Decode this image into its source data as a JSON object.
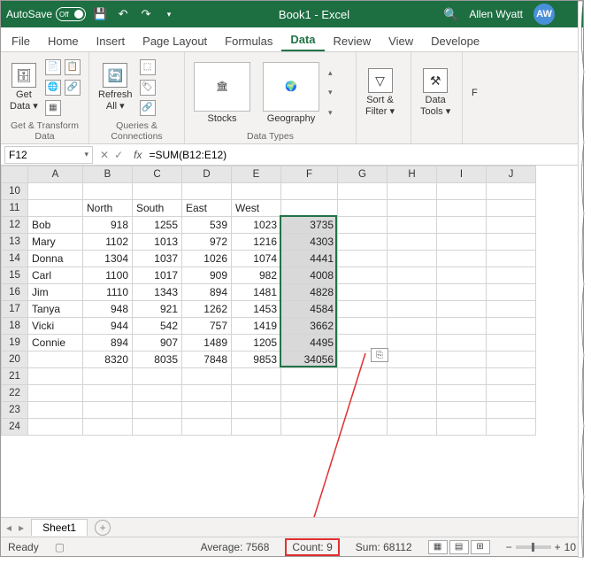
{
  "titlebar": {
    "autosave_label": "AutoSave",
    "toggle_state": "Off",
    "book_title": "Book1 - Excel",
    "user_name": "Allen Wyatt",
    "user_initials": "AW"
  },
  "tabs": [
    "File",
    "Home",
    "Insert",
    "Page Layout",
    "Formulas",
    "Data",
    "Review",
    "View",
    "Develope"
  ],
  "active_tab_index": 5,
  "ribbon": {
    "g1": {
      "btn1": "Get\nData ▾",
      "label": "Get & Transform Data"
    },
    "g2": {
      "btn1": "Refresh\nAll ▾",
      "label": "Queries & Connections"
    },
    "g3": {
      "btn1": "Stocks",
      "btn2": "Geography",
      "label": "Data Types"
    },
    "g4": {
      "btn1": "Sort &\nFilter ▾",
      "label": ""
    },
    "g5": {
      "btn1": "Data\nTools ▾",
      "label": ""
    },
    "g6": {
      "btn1": "F",
      "label": ""
    }
  },
  "formula_bar": {
    "name_box": "F12",
    "formula": "=SUM(B12:E12)"
  },
  "columns": [
    "",
    "A",
    "B",
    "C",
    "D",
    "E",
    "F",
    "G",
    "H",
    "I",
    "J"
  ],
  "rows_visible": [
    10,
    11,
    12,
    13,
    14,
    15,
    16,
    17,
    18,
    19,
    20,
    21,
    22,
    23,
    24
  ],
  "data": {
    "11": {
      "A": "",
      "B": "North",
      "C": "South",
      "D": "East",
      "E": "West",
      "F": ""
    },
    "12": {
      "A": "Bob",
      "B": 918,
      "C": 1255,
      "D": 539,
      "E": 1023,
      "F": 3735
    },
    "13": {
      "A": "Mary",
      "B": 1102,
      "C": 1013,
      "D": 972,
      "E": 1216,
      "F": 4303
    },
    "14": {
      "A": "Donna",
      "B": 1304,
      "C": 1037,
      "D": 1026,
      "E": 1074,
      "F": 4441
    },
    "15": {
      "A": "Carl",
      "B": 1100,
      "C": 1017,
      "D": 909,
      "E": 982,
      "F": 4008
    },
    "16": {
      "A": "Jim",
      "B": 1110,
      "C": 1343,
      "D": 894,
      "E": 1481,
      "F": 4828
    },
    "17": {
      "A": "Tanya",
      "B": 948,
      "C": 921,
      "D": 1262,
      "E": 1453,
      "F": 4584
    },
    "18": {
      "A": "Vicki",
      "B": 944,
      "C": 542,
      "D": 757,
      "E": 1419,
      "F": 3662
    },
    "19": {
      "A": "Connie",
      "B": 894,
      "C": 907,
      "D": 1489,
      "E": 1205,
      "F": 4495
    },
    "20": {
      "A": "",
      "B": 8320,
      "C": 8035,
      "D": 7848,
      "E": 9853,
      "F": 34056
    }
  },
  "selection": {
    "col": "F",
    "rows": [
      12,
      20
    ]
  },
  "sheet_tabs": {
    "active": "Sheet1"
  },
  "statusbar": {
    "ready": "Ready",
    "average": "Average: 7568",
    "count": "Count: 9",
    "sum": "Sum: 68112",
    "zoom": "10"
  }
}
